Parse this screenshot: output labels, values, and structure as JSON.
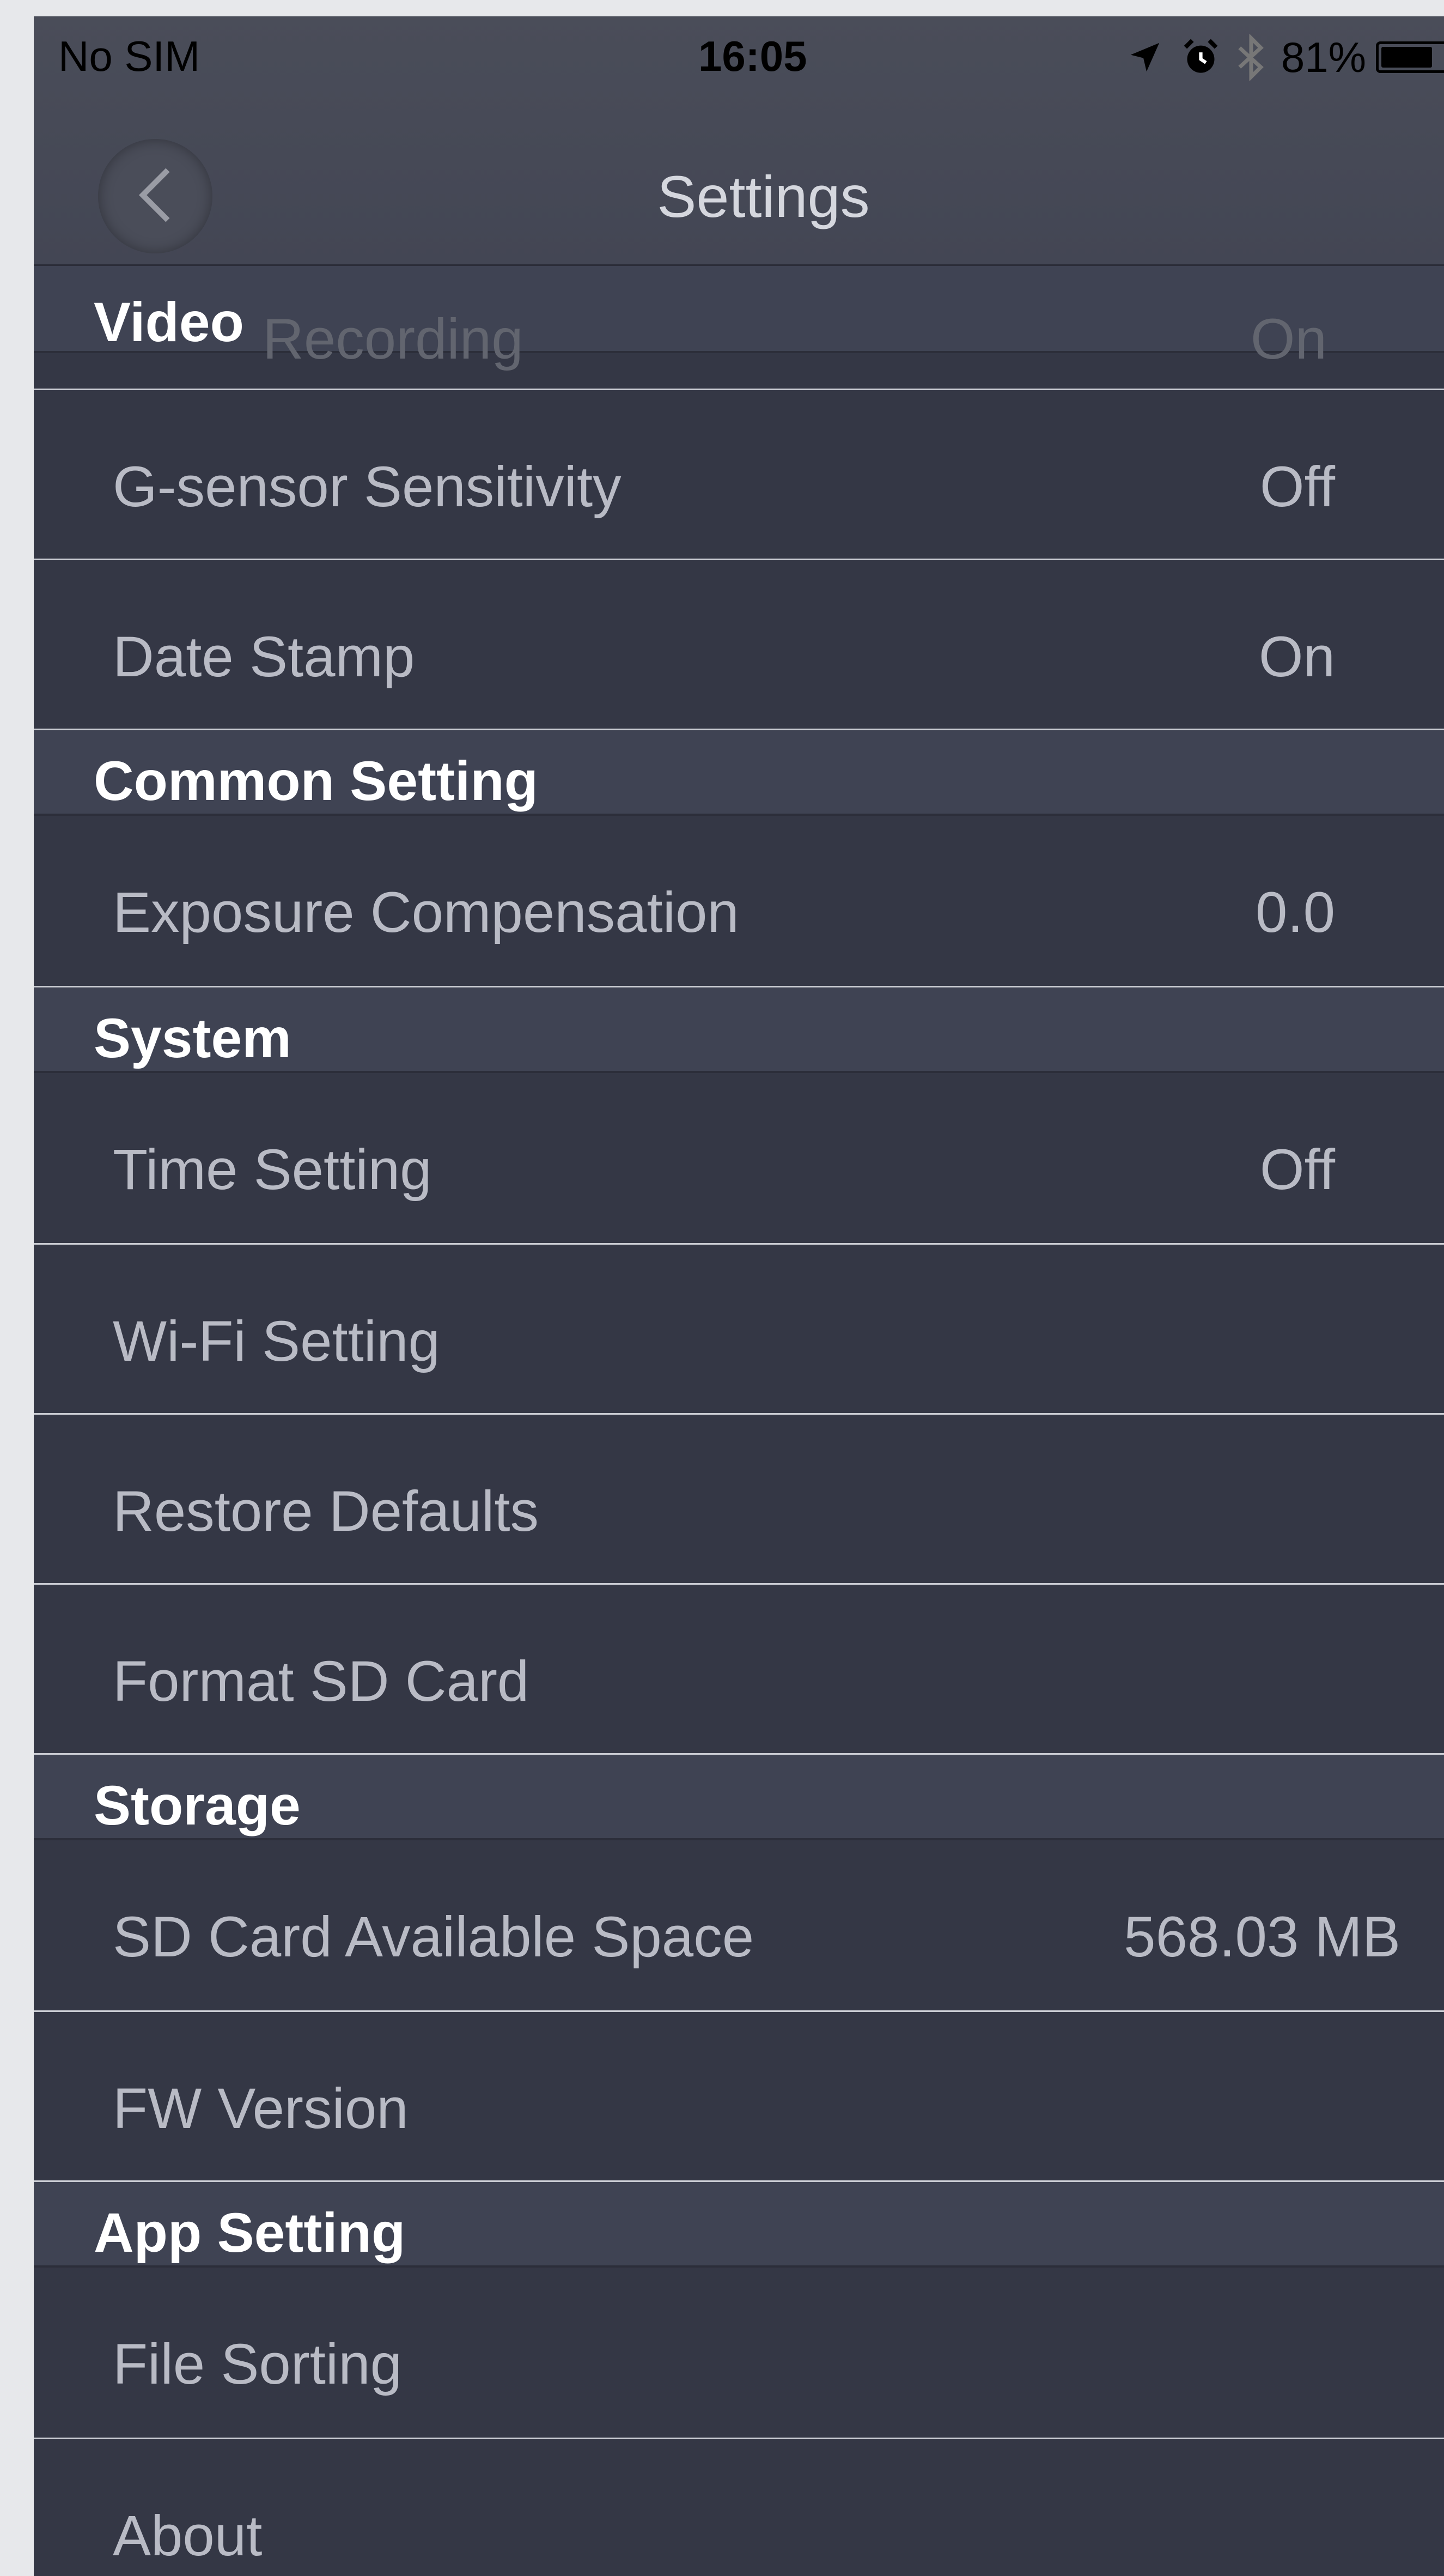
{
  "status_bar": {
    "carrier": "No SIM",
    "time": "16:05",
    "battery": "81%",
    "battery_level": 0.81,
    "icons": [
      "location-arrow-icon",
      "alarm-icon",
      "bluetooth-icon",
      "battery-icon"
    ]
  },
  "nav": {
    "title": "Settings",
    "back_icon": "chevron-left-icon"
  },
  "colors": {
    "background": "#343745",
    "header": "#3f4353",
    "text": "#b9bbc5",
    "header_text": "#ffffff"
  },
  "sections": {
    "video": {
      "title": "Video",
      "ghost_row": {
        "label": "Recording",
        "value": "On"
      },
      "rows": [
        {
          "label": "G-sensor Sensitivity",
          "value": "Off"
        },
        {
          "label": "Date Stamp",
          "value": "On"
        }
      ]
    },
    "common": {
      "title": "Common Setting",
      "rows": [
        {
          "label": "Exposure Compensation",
          "value": "0.0"
        }
      ]
    },
    "system": {
      "title": "System",
      "rows": [
        {
          "label": "Time Setting",
          "value": "Off"
        },
        {
          "label": "Wi-Fi Setting",
          "value": ""
        },
        {
          "label": "Restore Defaults",
          "value": ""
        },
        {
          "label": "Format SD Card",
          "value": ""
        }
      ]
    },
    "storage": {
      "title": "Storage",
      "rows": [
        {
          "label": "SD Card Available Space",
          "value": "568.03 MB"
        },
        {
          "label": "FW Version",
          "value": ""
        }
      ]
    },
    "app": {
      "title": "App Setting",
      "rows": [
        {
          "label": "File Sorting",
          "value": ""
        },
        {
          "label": "About",
          "value": ""
        }
      ]
    }
  }
}
